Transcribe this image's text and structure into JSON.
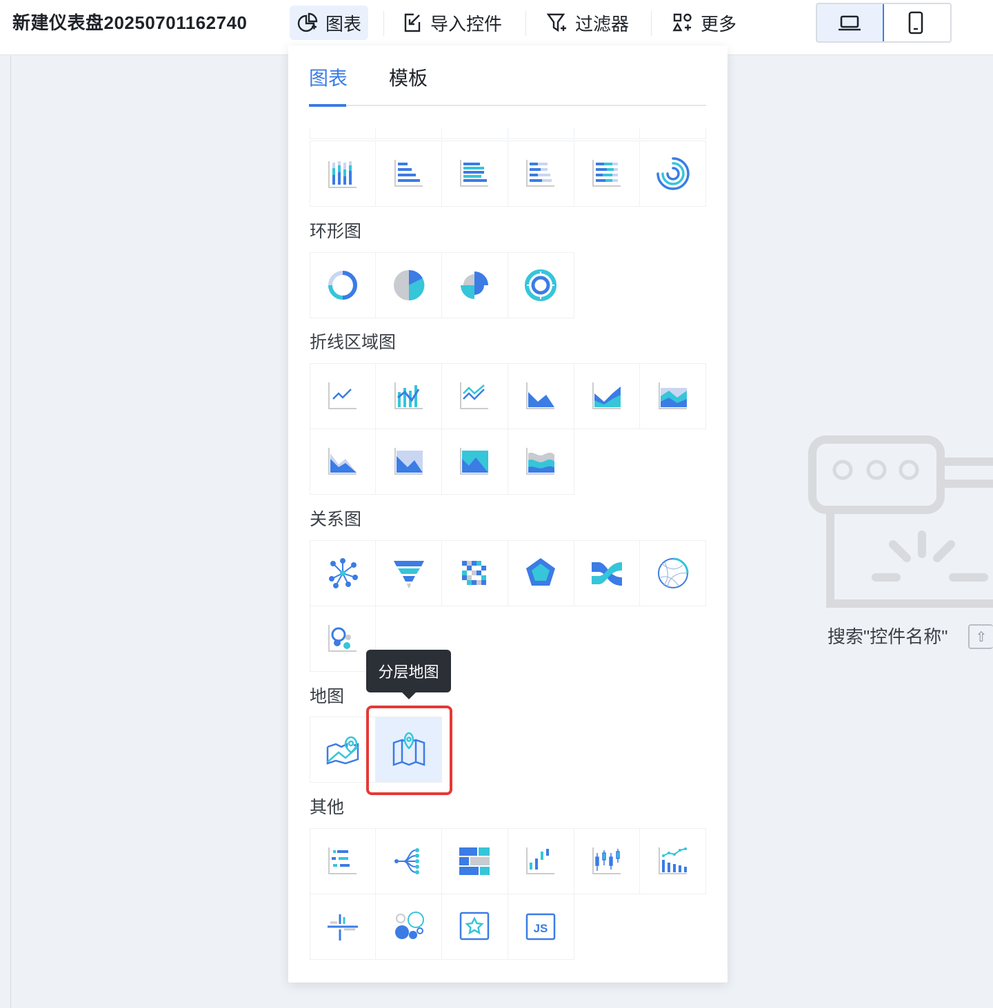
{
  "toolbar": {
    "doc_title": "新建仪表盘20250701162740",
    "chart_label": "图表",
    "import_label": "导入控件",
    "filter_label": "过滤器",
    "more_label": "更多"
  },
  "panel": {
    "tabs": [
      "图表",
      "模板"
    ],
    "sections": {
      "ring": "环形图",
      "line": "折线区域图",
      "relation": "关系图",
      "map": "地图",
      "other": "其他"
    },
    "tooltip": "分层地图"
  },
  "empty_state": {
    "search_hint": "搜索\"控件名称\"",
    "key_icon": "⇧"
  }
}
